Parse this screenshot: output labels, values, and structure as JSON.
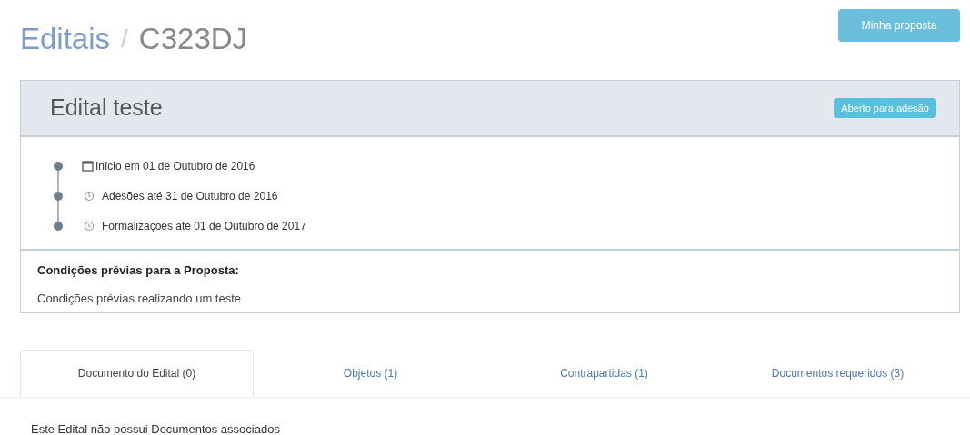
{
  "breadcrumb": [
    {
      "label": "Editais",
      "kind": "link"
    },
    {
      "label": "/",
      "kind": "separator"
    },
    {
      "label": "C323DJ",
      "kind": "current"
    }
  ],
  "proposal_button": "Minha proposta",
  "card": {
    "title": "Edital teste",
    "status_badge": "Aberto para adesão",
    "timeline": [
      {
        "kind": "calendar",
        "text": "Início em 01 de Outubro de 2016"
      },
      {
        "kind": "clock",
        "text": "Adesões até 31 de Outubro de 2016"
      },
      {
        "kind": "clock",
        "text": "Formalizações até 01 de Outubro de 2017"
      }
    ],
    "conditions_heading": "Condições prévias para a Proposta:",
    "conditions_text": "Condições prévias realizando um teste"
  },
  "tabs": [
    {
      "label": "Documento do Edital (0)",
      "selected": true
    },
    {
      "label": "Objetos (1)",
      "selected": false
    },
    {
      "label": "Contrapartidas (1)",
      "selected": false
    },
    {
      "label": "Documentos requeridos (3)",
      "selected": false
    }
  ],
  "tab_content": "Este Edital não possui Documentos associados"
}
